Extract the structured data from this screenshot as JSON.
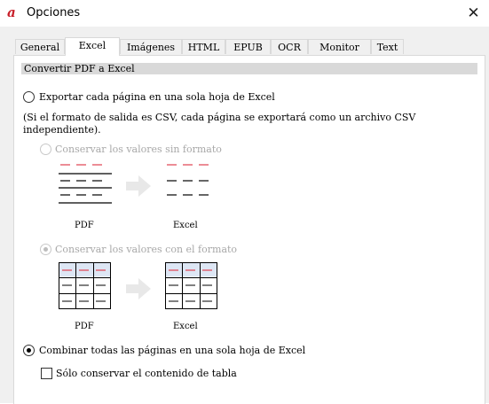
{
  "window": {
    "title": "Opciones",
    "close_glyph": "✕"
  },
  "tabs": [
    {
      "label": "General",
      "active": false
    },
    {
      "label": "Excel",
      "active": true
    },
    {
      "label": "Imágenes",
      "active": false
    },
    {
      "label": "HTML",
      "active": false
    },
    {
      "label": "EPUB",
      "active": false
    },
    {
      "label": "OCR",
      "active": false
    },
    {
      "label": "Monitor",
      "active": false
    },
    {
      "label": "Text",
      "active": false
    }
  ],
  "section": {
    "title": "Convertir PDF a Excel"
  },
  "options": {
    "per_page": {
      "label": "Exportar cada página en una sola hoja de Excel",
      "checked": false,
      "note_line1": "(Si el formato de salida es CSV, cada página se exportará como un archivo CSV",
      "note_line2": "independiente)."
    },
    "keep_values_no_format": {
      "label": "Conservar los valores sin formato",
      "checked": false,
      "enabled": false
    },
    "keep_values_with_format": {
      "label": "Conservar los valores con el formato",
      "checked": true,
      "enabled": false
    },
    "combine_all": {
      "label": "Combinar todas las páginas en una sola hoja de Excel",
      "checked": true
    },
    "table_only": {
      "label": "Sólo conservar el contenido de tabla",
      "checked": false
    }
  },
  "diagrams": {
    "pdf_caption": "PDF",
    "excel_caption": "Excel"
  },
  "icons": {
    "app": "app-logo-icon",
    "close": "close-icon",
    "arrow": "arrow-right-icon"
  },
  "colors": {
    "red_line": "#e0414f",
    "grid_header_fill": "#dde6f4",
    "arrow": "#e8e8e8"
  }
}
